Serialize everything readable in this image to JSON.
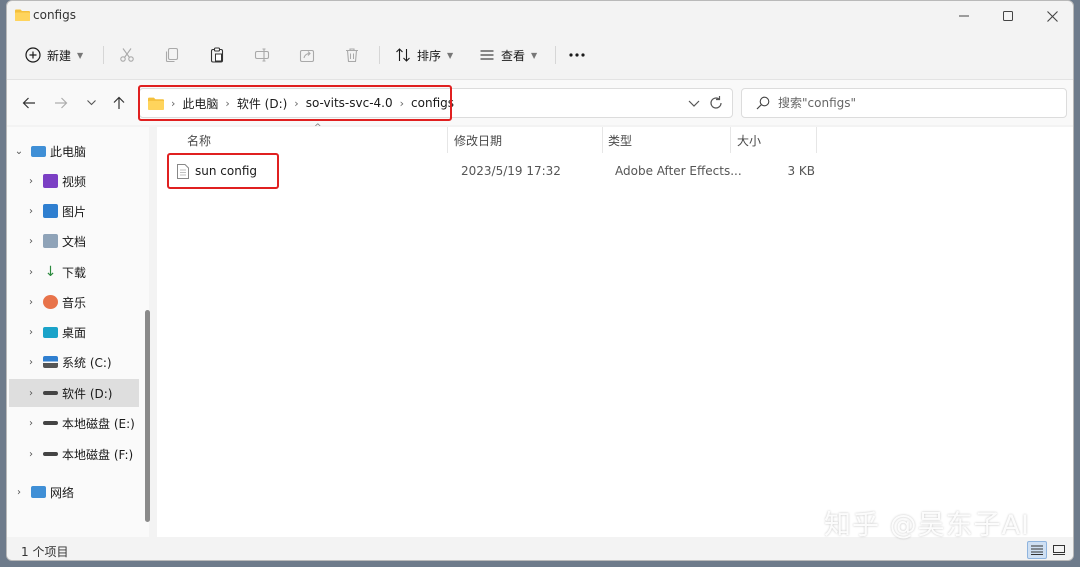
{
  "window": {
    "title": "configs"
  },
  "toolbar": {
    "new_label": "新建",
    "sort_label": "排序",
    "view_label": "查看"
  },
  "address": {
    "crumbs": [
      "此电脑",
      "软件 (D:)",
      "so-vits-svc-4.0",
      "configs"
    ]
  },
  "search": {
    "placeholder": "搜索\"configs\""
  },
  "nav": {
    "items": [
      {
        "label": "此电脑",
        "icon": "pc-icon"
      },
      {
        "label": "视频",
        "icon": "video-icon"
      },
      {
        "label": "图片",
        "icon": "pictures-icon"
      },
      {
        "label": "文档",
        "icon": "documents-icon"
      },
      {
        "label": "下载",
        "icon": "download-icon"
      },
      {
        "label": "音乐",
        "icon": "music-icon"
      },
      {
        "label": "桌面",
        "icon": "desktop-icon"
      },
      {
        "label": "系统 (C:)",
        "icon": "system-drive-icon"
      },
      {
        "label": "软件 (D:)",
        "icon": "drive-icon"
      },
      {
        "label": "本地磁盘 (E:)",
        "icon": "drive-icon"
      },
      {
        "label": "本地磁盘 (F:)",
        "icon": "drive-icon"
      },
      {
        "label": "网络",
        "icon": "network-icon"
      }
    ],
    "selected": "软件 (D:)"
  },
  "columns": {
    "name": "名称",
    "modified": "修改日期",
    "type": "类型",
    "size": "大小"
  },
  "files": [
    {
      "name": "sun config",
      "modified": "2023/5/19 17:32",
      "type": "Adobe After Effects...",
      "size": "3 KB"
    }
  ],
  "status": {
    "count": "1 个项目"
  },
  "watermark": "知乎 @吴东子AI",
  "colors": {
    "highlight_box": "#e02020",
    "selection": "#dedede",
    "folder": "#f4c03c"
  }
}
